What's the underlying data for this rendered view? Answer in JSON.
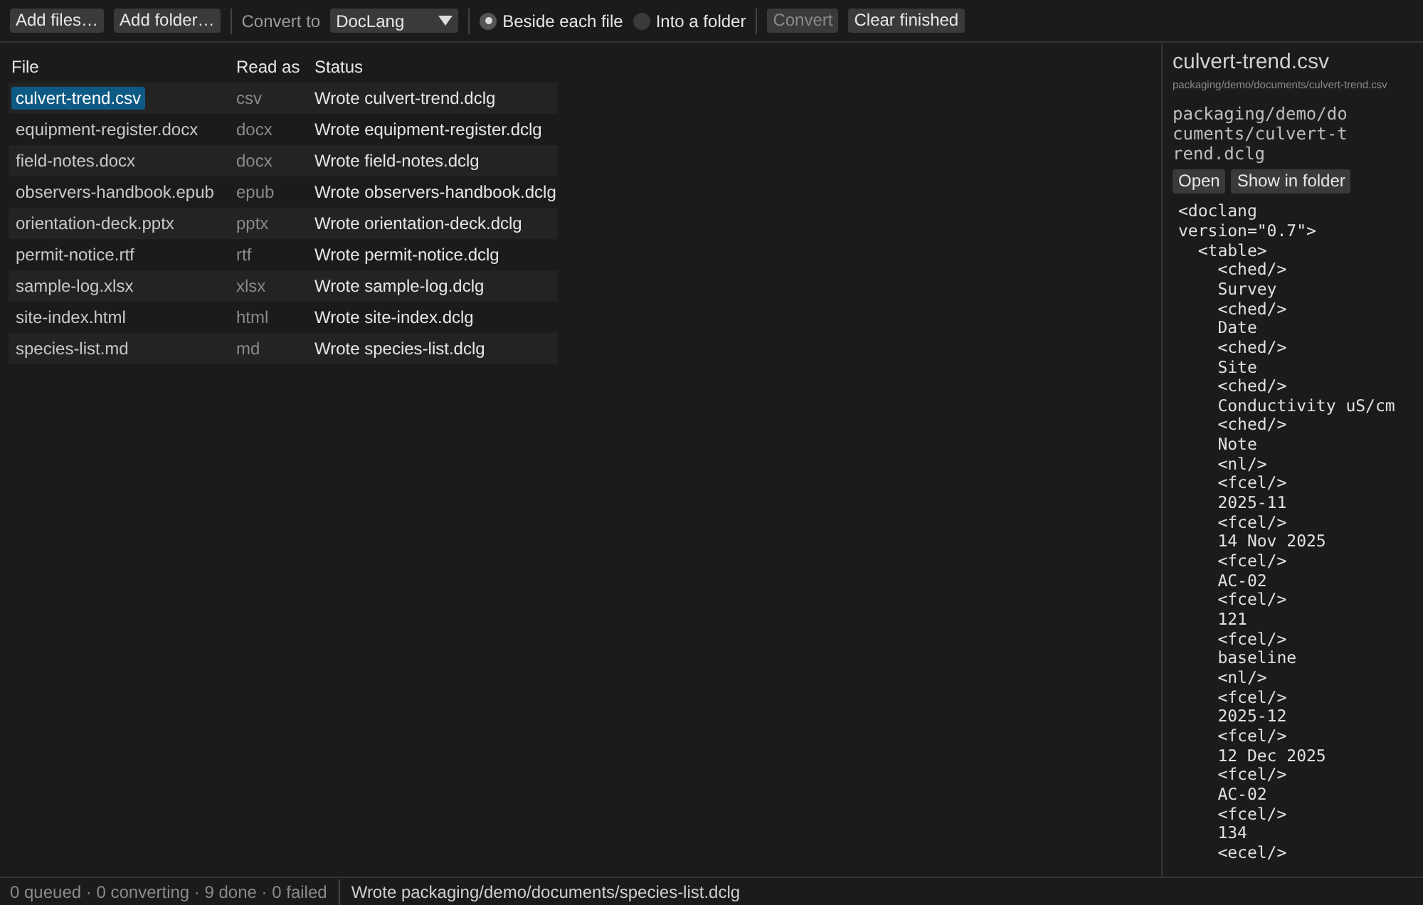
{
  "toolbar": {
    "add_files": "Add files…",
    "add_folder": "Add folder…",
    "convert_to_label": "Convert to",
    "format": "DocLang",
    "destinations": [
      {
        "label": "Beside each file",
        "selected": true
      },
      {
        "label": "Into a folder",
        "selected": false
      }
    ],
    "convert": {
      "label": "Convert",
      "disabled": true
    },
    "clear": {
      "label": "Clear finished",
      "disabled": false
    }
  },
  "table": {
    "columns": [
      "File",
      "Read as",
      "Status"
    ],
    "rows": [
      {
        "file": "culvert-trend.csv",
        "read_as": "csv",
        "status": "Wrote culvert-trend.dclg",
        "selected": true
      },
      {
        "file": "equipment-register.docx",
        "read_as": "docx",
        "status": "Wrote equipment-register.dclg",
        "selected": false
      },
      {
        "file": "field-notes.docx",
        "read_as": "docx",
        "status": "Wrote field-notes.dclg",
        "selected": false
      },
      {
        "file": "observers-handbook.epub",
        "read_as": "epub",
        "status": "Wrote observers-handbook.dclg",
        "selected": false
      },
      {
        "file": "orientation-deck.pptx",
        "read_as": "pptx",
        "status": "Wrote orientation-deck.dclg",
        "selected": false
      },
      {
        "file": "permit-notice.rtf",
        "read_as": "rtf",
        "status": "Wrote permit-notice.dclg",
        "selected": false
      },
      {
        "file": "sample-log.xlsx",
        "read_as": "xlsx",
        "status": "Wrote sample-log.dclg",
        "selected": false
      },
      {
        "file": "site-index.html",
        "read_as": "html",
        "status": "Wrote site-index.dclg",
        "selected": false
      },
      {
        "file": "species-list.md",
        "read_as": "md",
        "status": "Wrote species-list.dclg",
        "selected": false
      }
    ]
  },
  "detail": {
    "title": "culvert-trend.csv",
    "source_path": "packaging/demo/documents/culvert-trend.csv",
    "output_path": "packaging/demo/documents/culvert-trend.dclg",
    "open": "Open",
    "show_in_folder": "Show in folder",
    "preview": "<doclang\nversion=\"0.7\">\n  <table>\n    <ched/>\n    Survey\n    <ched/>\n    Date\n    <ched/>\n    Site\n    <ched/>\n    Conductivity uS/cm\n    <ched/>\n    Note\n    <nl/>\n    <fcel/>\n    2025-11\n    <fcel/>\n    14 Nov 2025\n    <fcel/>\n    AC-02\n    <fcel/>\n    121\n    <fcel/>\n    baseline\n    <nl/>\n    <fcel/>\n    2025-12\n    <fcel/>\n    12 Dec 2025\n    <fcel/>\n    AC-02\n    <fcel/>\n    134\n    <ecel/>"
  },
  "status_bar": {
    "counts": "0 queued · 0 converting · 9 done · 0 failed",
    "message": "Wrote packaging/demo/documents/species-list.dclg"
  }
}
